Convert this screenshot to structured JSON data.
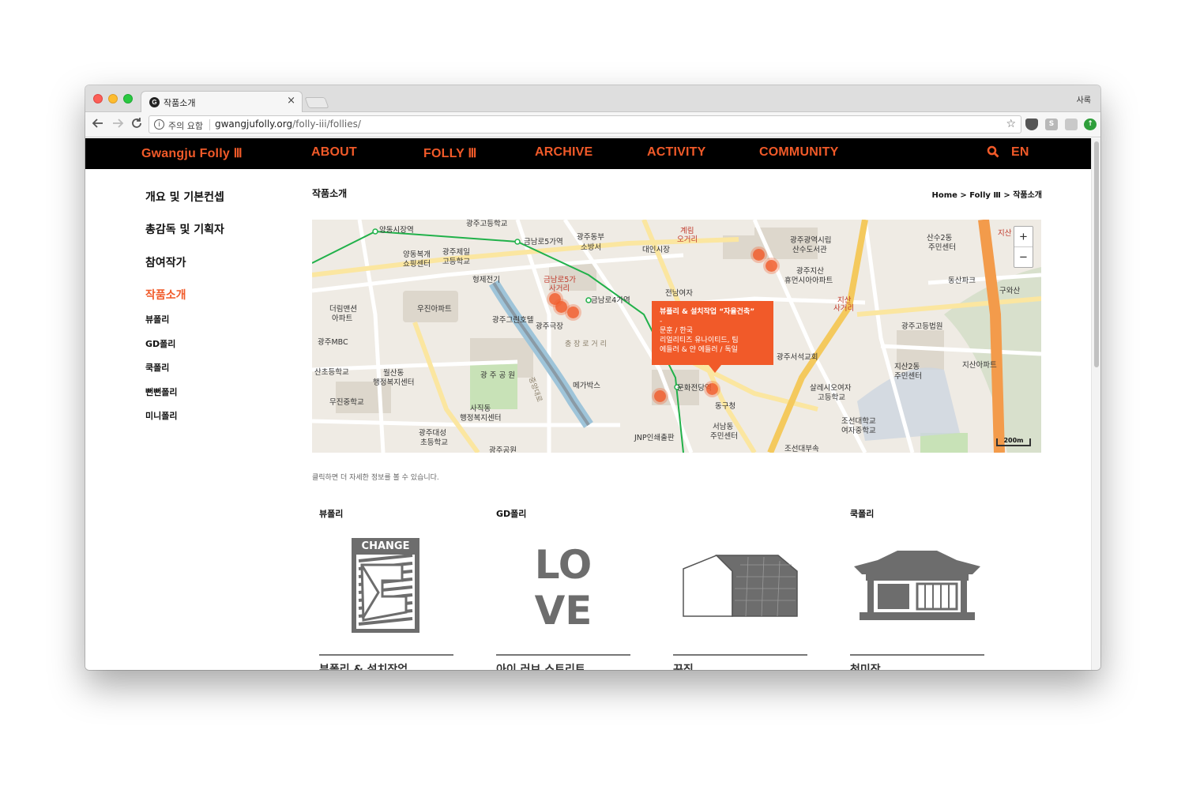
{
  "browser": {
    "tab_title": "작품소개",
    "tab_close": "×",
    "profile": "사록",
    "security_label": "주의 요함",
    "url_host": "gwangjufolly.org",
    "url_path": "/folly-iii/follies/",
    "favicon": "G"
  },
  "site_nav": {
    "logo": "Gwangju Folly Ⅲ",
    "items": [
      "ABOUT",
      "FOLLY Ⅲ",
      "ARCHIVE",
      "ACTIVITY",
      "COMMUNITY"
    ],
    "search_icon": "search-icon",
    "lang": "EN"
  },
  "sidebar": {
    "items": [
      {
        "label": "개요 및 기본컨셉"
      },
      {
        "label": "총감독 및 기획자"
      },
      {
        "label": "참여작가"
      },
      {
        "label": "작품소개"
      },
      {
        "label": "뷰폴리"
      },
      {
        "label": "GD폴리"
      },
      {
        "label": "쿡폴리"
      },
      {
        "label": "뻔뻔폴리"
      },
      {
        "label": "미니폴리"
      }
    ]
  },
  "content": {
    "title": "작품소개",
    "breadcrumb": "Home > Folly Ⅲ > 작품소개",
    "hint": "클릭하면 더 자세한 정보를 볼 수 있습니다."
  },
  "map": {
    "zoom_in": "+",
    "zoom_out": "−",
    "scale": "200m",
    "popup": {
      "title": "뷰폴리 & 설치작업 “자율건축”",
      "dash": "-",
      "line1": "문훈 / 한국",
      "line2": "리얼리티즈 유나이티드, 팀",
      "line3": "에들러 & 얀 에들러 / 독일"
    },
    "labels": [
      "광주고등학교",
      "양동시장역",
      "양동복개",
      "쇼핑센터",
      "광주제일",
      "고등학교",
      "금남로5가역",
      "광주동부",
      "소방서",
      "대인시장",
      "계림",
      "오거리",
      "광주광역시립",
      "산수도서관",
      "산수2동",
      "주민센터",
      "지산",
      "형제전기",
      "금남로5가",
      "사거리",
      "금남로4가역",
      "광주지산",
      "휴먼시아아파트",
      "동산파크",
      "구와산",
      "더림맨션",
      "아파트",
      "우진아파트",
      "광주그린호텔",
      "광주극장",
      "전남여자",
      "지산",
      "사거리",
      "광주MBC",
      "충 장 로 거 리",
      "광주고등법원",
      "광주서석교회",
      "지산2동",
      "주민센터",
      "지산아파트",
      "산초등학교",
      "월산동",
      "행정복지센터",
      "광 주 공 원",
      "메가박스",
      "문화전당역",
      "살레시오여자",
      "고등학교",
      "무진중학교",
      "사직동",
      "행정복지센터",
      "동구청",
      "조선대학교",
      "여자중학교",
      "광주대성",
      "초등학교",
      "JNP인쇄출판",
      "서남동",
      "주민센터",
      "조선대부속",
      "중앙대로",
      "광주공원"
    ]
  },
  "categories": [
    "뷰폴리",
    "GD폴리",
    "쿡폴리"
  ],
  "cards": [
    {
      "title": "뷰폴리 & 설치작업",
      "icon": "change-icon",
      "icon_text": "CHANGE"
    },
    {
      "title": "아이 러브 스트리트",
      "icon": "love-icon",
      "icon_text_top": "LO",
      "icon_text_bottom": "VE"
    },
    {
      "title": "꾸짐",
      "icon": "house-icon"
    },
    {
      "title": "천미장",
      "icon": "hanok-icon"
    }
  ],
  "colors": {
    "accent": "#f15a29",
    "nav_bg": "#000000"
  }
}
